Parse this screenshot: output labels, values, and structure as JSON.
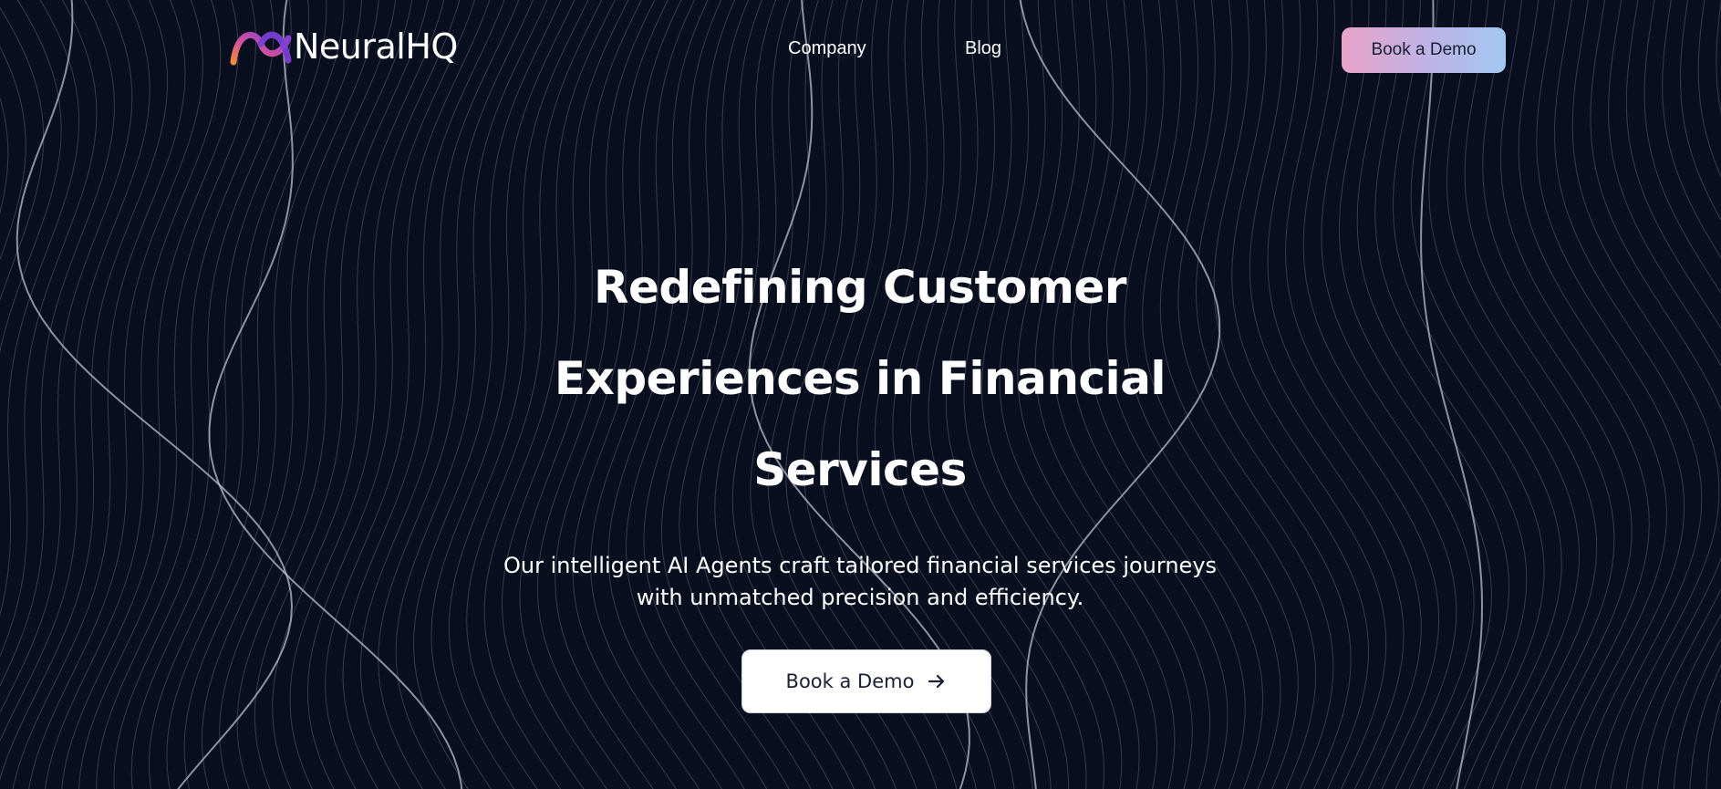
{
  "brand": {
    "name": "NeuralHQ",
    "logo_icon": "arc-logo-icon",
    "logo_colors": [
      "#7b3fd6",
      "#d34fa0",
      "#f08a3a"
    ]
  },
  "nav": {
    "items": [
      {
        "label": "Company"
      },
      {
        "label": "Blog"
      }
    ],
    "cta_label": "Book a Demo"
  },
  "hero": {
    "title": "Redefining Customer Experiences in Financial Services",
    "subtitle": "Our intelligent AI Agents craft tailored financial services journeys with unmatched precision and efficiency.",
    "cta_label": "Book a Demo",
    "cta_icon": "arrow-right-icon"
  },
  "colors": {
    "background": "#0a0f1f",
    "text": "#ffffff",
    "header_cta_gradient": [
      "#e8a3c9",
      "#bcb4e6",
      "#a3c8f3"
    ]
  }
}
